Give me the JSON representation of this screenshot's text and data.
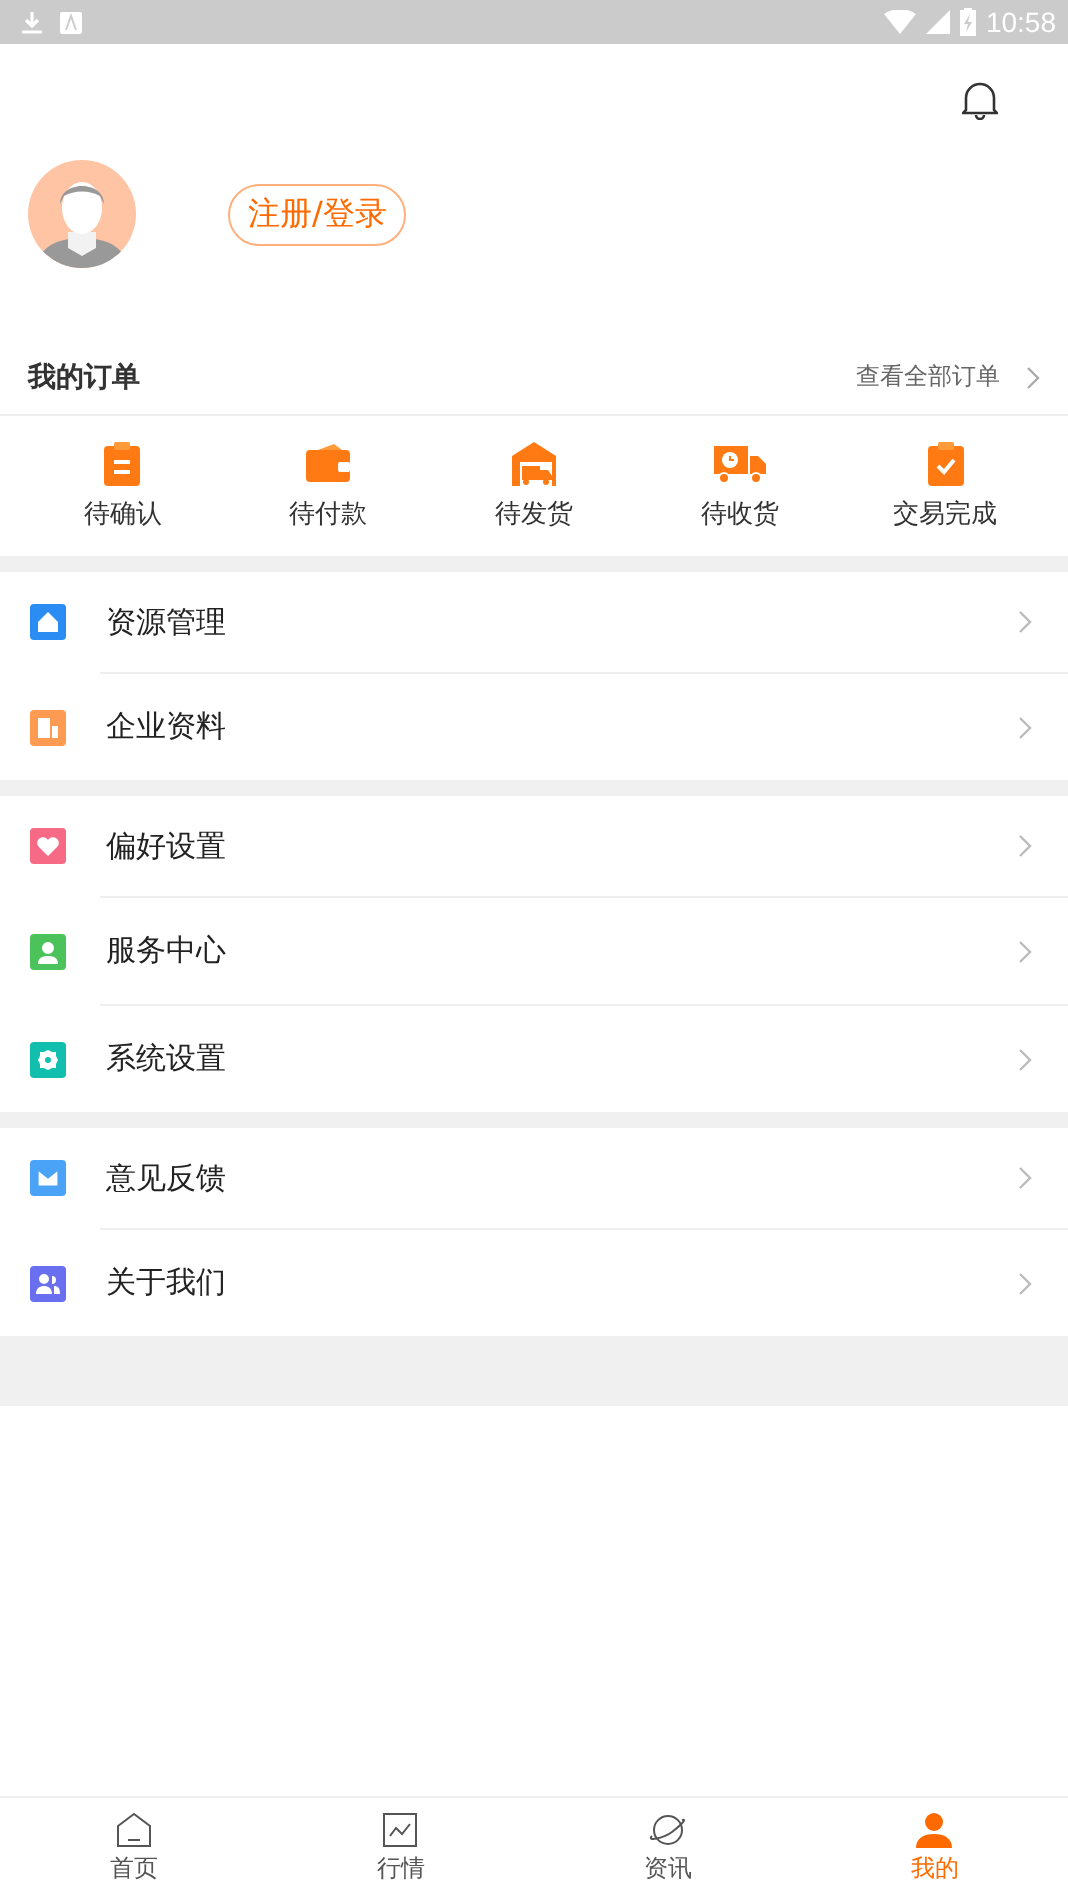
{
  "status_bar": {
    "time": "10:58"
  },
  "profile": {
    "login_button": "注册/登录"
  },
  "orders": {
    "title": "我的订单",
    "view_all": "查看全部订单",
    "items": [
      {
        "label": "待确认",
        "kind": "clipboard"
      },
      {
        "label": "待付款",
        "kind": "wallet"
      },
      {
        "label": "待发货",
        "kind": "warehouse"
      },
      {
        "label": "待收货",
        "kind": "truck"
      },
      {
        "label": "交易完成",
        "kind": "check"
      }
    ]
  },
  "menu_groups": [
    [
      {
        "label": "资源管理",
        "kind": "house",
        "color": "#2b8cf3"
      },
      {
        "label": "企业资料",
        "kind": "building",
        "color": "#ff9a52"
      }
    ],
    [
      {
        "label": "偏好设置",
        "kind": "heart",
        "color": "#f66a85"
      },
      {
        "label": "服务中心",
        "kind": "person",
        "color": "#4cc35a"
      },
      {
        "label": "系统设置",
        "kind": "gear",
        "color": "#12bfae"
      }
    ],
    [
      {
        "label": "意见反馈",
        "kind": "mail",
        "color": "#4aa3f7"
      },
      {
        "label": "关于我们",
        "kind": "people",
        "color": "#6a6ff0"
      }
    ]
  ],
  "tab_bar": [
    {
      "label": "首页",
      "kind": "home",
      "selected": false
    },
    {
      "label": "行情",
      "kind": "chart",
      "selected": false
    },
    {
      "label": "资讯",
      "kind": "planet",
      "selected": false
    },
    {
      "label": "我的",
      "kind": "user",
      "selected": true
    }
  ]
}
